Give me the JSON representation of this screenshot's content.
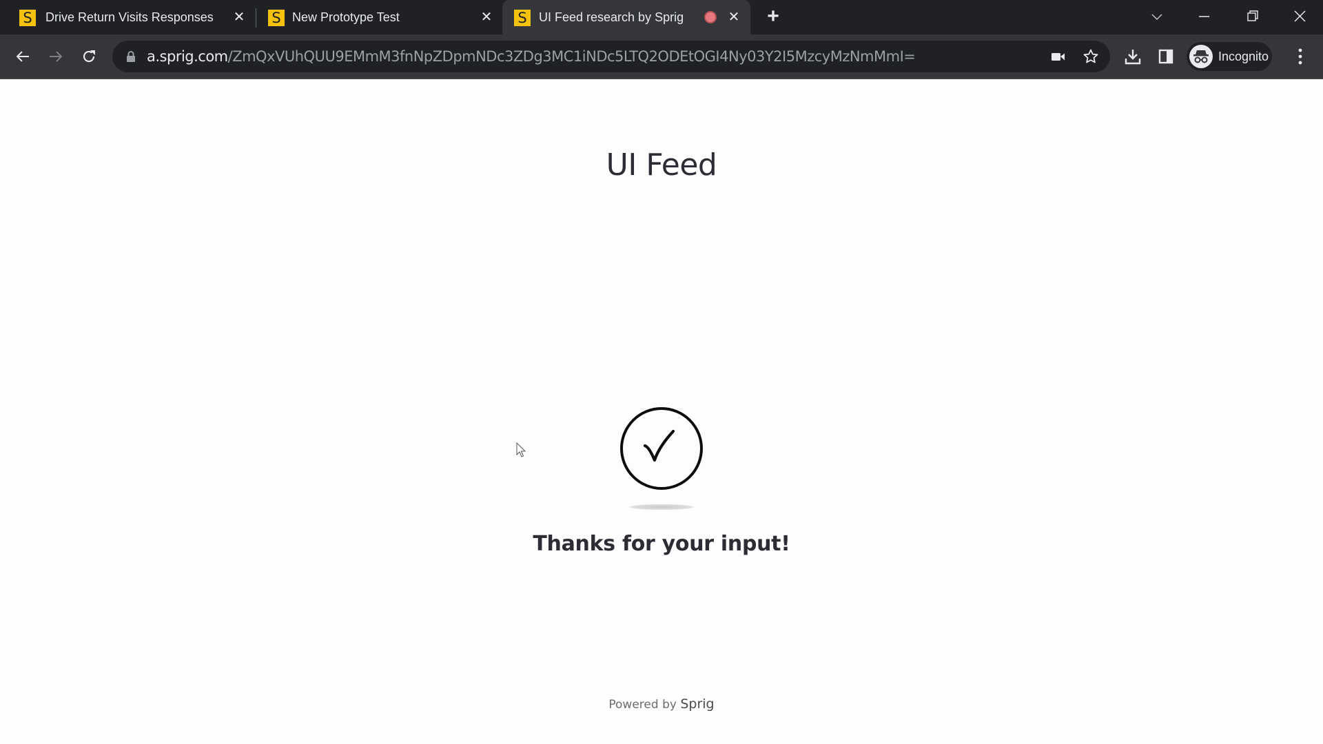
{
  "browser": {
    "tabs": [
      {
        "title": "Drive Return Visits Responses",
        "favicon": "S",
        "active": false
      },
      {
        "title": "New Prototype Test",
        "favicon": "S",
        "active": false
      },
      {
        "title": "UI Feed research by Sprig",
        "favicon": "S",
        "active": true,
        "recording": true
      }
    ],
    "new_tab_label": "+",
    "close_glyph": "✕",
    "address_bar": {
      "host": "a.sprig.com",
      "path": "/ZmQxVUhQUU9EMmM3fnNpZDpmNDc3ZDg3MC1iNDc5LTQ2ODEtOGI4Ny03Y2I5MzcyMzNmMmI="
    },
    "profile_label": "Incognito",
    "accent_colors": {
      "favicon": "#f4c20d",
      "recording": "#e8777f"
    }
  },
  "page": {
    "title": "UI Feed",
    "completion_icon": "checkmark-circle-icon",
    "message": "Thanks for your input!",
    "footer": {
      "prefix": "Powered by",
      "brand": "Sprig"
    }
  }
}
